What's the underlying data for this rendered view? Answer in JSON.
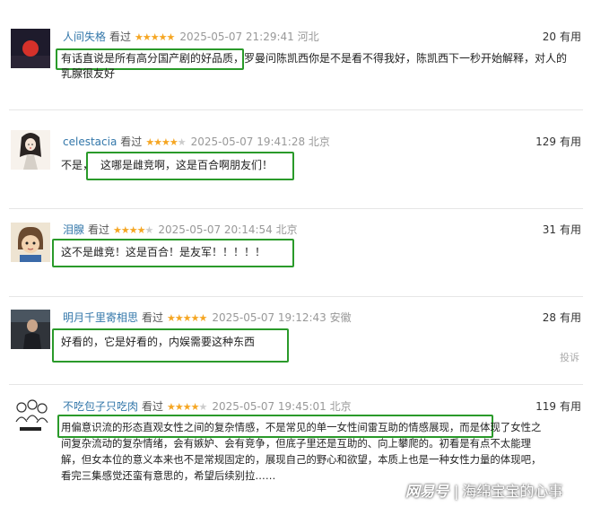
{
  "reviews": [
    {
      "user": "人间失格",
      "watched": "看过",
      "stars": "★★★★★",
      "stars_off": "",
      "time": "2025-05-07 21:29:41 河北",
      "votes": "20",
      "votes_label": "有用",
      "line1_highlight": "有话直说是所有高分国产剧的好品质，",
      "line1_rest": "罗曼问陈凯西你是不是看不得我好，陈凯西下一秒开始解释，对人的",
      "line2": "乳腺很友好"
    },
    {
      "user": "celestacia",
      "watched": "看过",
      "stars": "★★★★",
      "stars_off": "★",
      "time": "2025-05-07 19:41:28 北京",
      "votes": "129",
      "votes_label": "有用",
      "text_prefix": "不是，",
      "text_highlight": "这哪是雌竞啊，这是百合啊朋友们！"
    },
    {
      "user": "泪腺",
      "watched": "看过",
      "stars": "★★★★",
      "stars_off": "★",
      "time": "2025-05-07 20:14:54 北京",
      "votes": "31",
      "votes_label": "有用",
      "text_highlight": "这不是雌竞！这是百合！是友军！！！！！"
    },
    {
      "user": "明月千里寄相思",
      "watched": "看过",
      "stars": "★★★★★",
      "stars_off": "",
      "time": "2025-05-07 19:12:43 安徽",
      "votes": "28",
      "votes_label": "有用",
      "text_highlight": "好看的，它是好看的，内娱需要这种东西",
      "report": "投诉"
    },
    {
      "user": "不吃包子只吃肉",
      "watched": "看过",
      "stars": "★★★★",
      "stars_off": "★",
      "time": "2025-05-07 19:45:01 北京",
      "votes": "119",
      "votes_label": "有用",
      "line1_highlight": "用偏意识流的形态直观女性之间的复杂情感，不是常见的单一女性间雷互助的情感展现，",
      "line1_rest": "而是体现了女性之",
      "line2": "间复杂流动的复杂情绪，会有嫉妒、会有竞争，但底子里还是互助的、向上攀爬的。初看是有点不太能理",
      "line3": "解，但女本位的意义本来也不是常规固定的，展现自己的野心和欲望，本质上也是一种女性力量的体现吧，",
      "line4": "看完三集感觉还蛮有意思的，希望后续别拉……"
    }
  ],
  "watermark": {
    "logo": "网易号",
    "separator": "|",
    "author": "海绵宝宝的心事"
  },
  "colors": {
    "highlight_box": "#2a9a2a",
    "username": "#3377aa",
    "star": "#f5a623"
  }
}
